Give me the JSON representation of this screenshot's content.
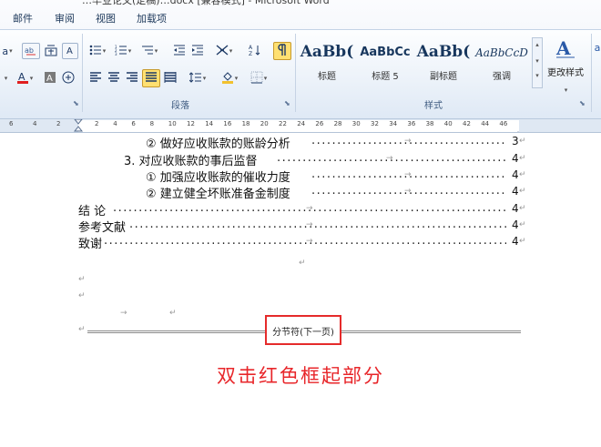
{
  "window": {
    "title_fragment": "…毕业论文(定稿)…docx [兼容模式] - Microsoft Word"
  },
  "tabs": [
    "邮件",
    "审阅",
    "视图",
    "加载项"
  ],
  "ribbon": {
    "font_group": {
      "font_size_suffix": "a",
      "hl_color": "#ffe071"
    },
    "paragraph_group": {
      "label": "段落"
    },
    "styles_group": {
      "label": "样式",
      "styles": [
        {
          "sample": "AaBb(",
          "name": "标题"
        },
        {
          "sample": "AaBbCc",
          "name": "标题 5"
        },
        {
          "sample": "AaBb(",
          "name": "副标题"
        },
        {
          "sample": "AaBbCcD",
          "name": "强调"
        }
      ],
      "change_styles_label": "更改样式"
    }
  },
  "ruler": {
    "numbers_left": [
      "6",
      "4",
      "2"
    ],
    "numbers_right": [
      "2",
      "4",
      "6",
      "8",
      "10",
      "12",
      "14",
      "16",
      "18",
      "20",
      "22",
      "24",
      "26",
      "28",
      "30",
      "32",
      "34",
      "36",
      "38",
      "40",
      "42",
      "44",
      "46"
    ]
  },
  "document": {
    "toc": [
      {
        "text": "② 做好应收账款的账龄分析",
        "page": "3"
      },
      {
        "text": "3. 对应收账款的事后监督",
        "page": "4"
      },
      {
        "text": "① 加强应收账款的催收力度",
        "page": "4"
      },
      {
        "text": "② 建立健全坏账准备金制度",
        "page": "4"
      },
      {
        "text": "结 论",
        "page": "4"
      },
      {
        "text": "参考文献",
        "page": "4"
      },
      {
        "text": "致谢",
        "page": "4"
      }
    ],
    "section_break_label": "分节符(下一页)",
    "instruction": "双击红色框起部分",
    "accent_color": "#e52b2b"
  }
}
